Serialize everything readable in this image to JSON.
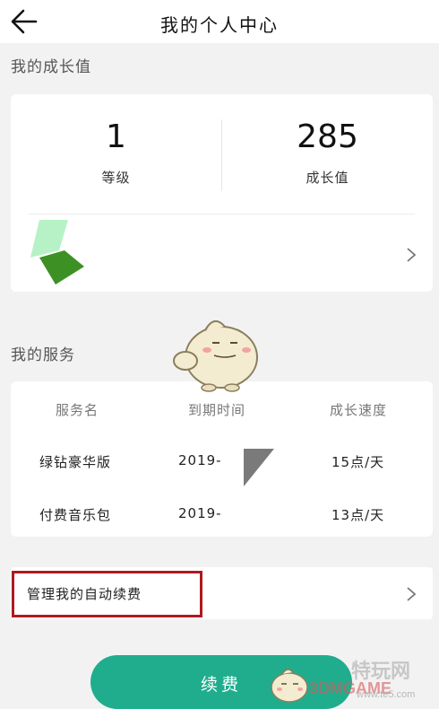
{
  "header": {
    "title": "我的个人中心",
    "back_icon": "arrow-left-icon"
  },
  "growth": {
    "section_label": "我的成长值",
    "level": {
      "value": "1",
      "label": "等级"
    },
    "growth_value": {
      "value": "285",
      "label": "成长值"
    }
  },
  "services": {
    "section_label": "我的服务",
    "columns": [
      "服务名",
      "到期时间",
      "成长速度"
    ],
    "rows": [
      {
        "name": "绿钻豪华版",
        "expiry": "2019-",
        "speed": "15点/天"
      },
      {
        "name": "付费音乐包",
        "expiry": "2019-",
        "speed": "13点/天"
      }
    ]
  },
  "manage": {
    "label": "管理我的自动续费",
    "highlight_color": "#b0191e"
  },
  "renew": {
    "label": "续费"
  },
  "watermark": {
    "site_cn": "特玩网",
    "site_en": "3DMGAME",
    "url": "www.te5.com"
  },
  "colors": {
    "accent": "#20ad8e",
    "background": "#f2f2f2"
  }
}
